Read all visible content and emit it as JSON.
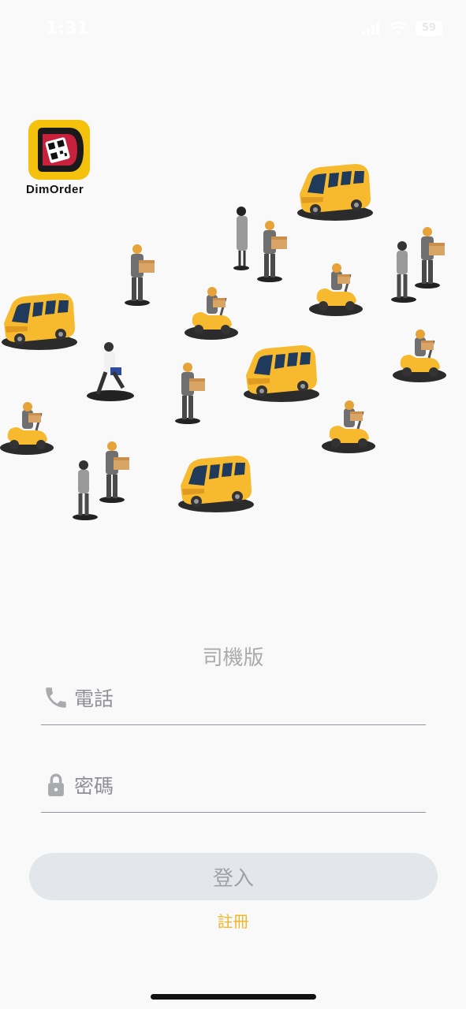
{
  "status_bar": {
    "time": "1:31",
    "battery": "59"
  },
  "logo": {
    "name": "DimOrder"
  },
  "app": {
    "subtitle": "司機版"
  },
  "form": {
    "phone_placeholder": "電話",
    "password_placeholder": "密碼",
    "login_label": "登入",
    "register_label": "註冊"
  },
  "colors": {
    "accent": "#f0b62c",
    "vehicle": "#f7b92e",
    "button_bg": "#e3e6ea",
    "underline": "#8a97a6"
  },
  "icons": {
    "phone": "phone-icon",
    "password": "lock-icon",
    "signal": "signal-icon",
    "wifi": "wifi-icon",
    "battery": "battery-icon"
  }
}
